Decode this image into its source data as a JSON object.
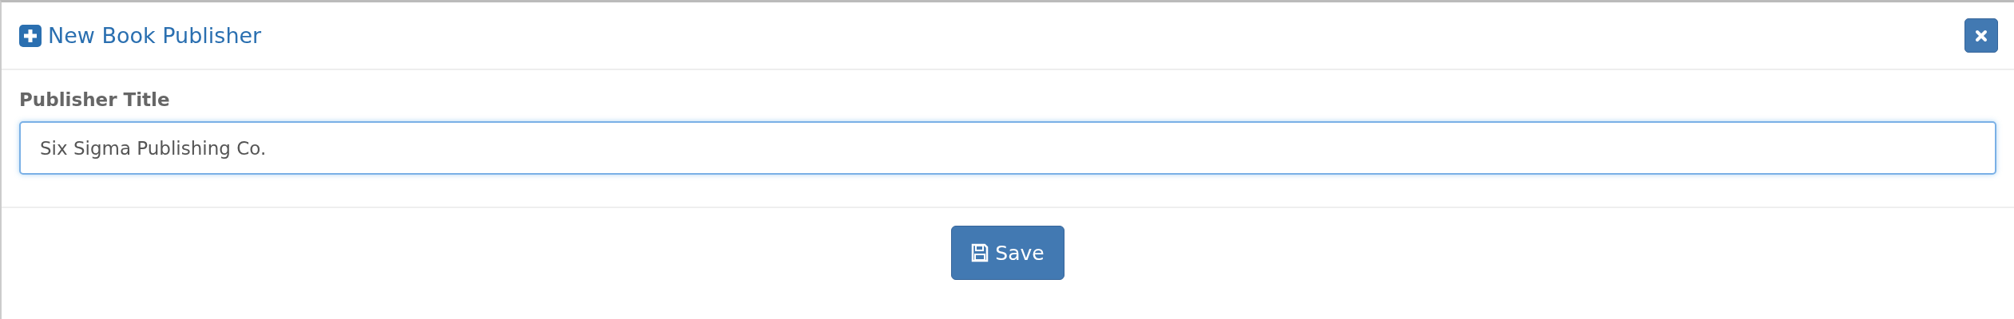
{
  "dialog": {
    "title": "New Book Publisher"
  },
  "form": {
    "label": "Publisher Title",
    "value": "Six Sigma Publishing Co."
  },
  "buttons": [
    {
      "label": "Save"
    }
  ]
}
